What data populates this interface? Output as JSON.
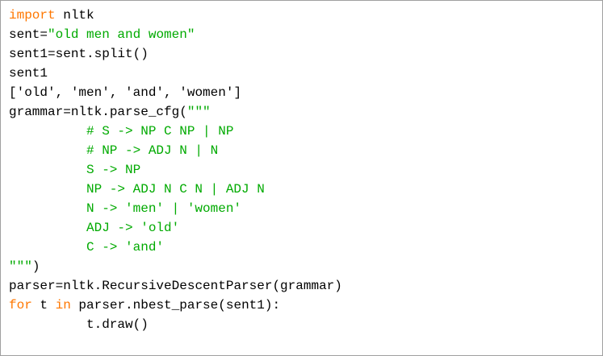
{
  "editor": {
    "lines": [
      {
        "kw": "import",
        "text": " nltk"
      },
      {
        "text": "sent=",
        "str": "\"old men and women\""
      },
      {
        "text": "sent1=sent.split()"
      },
      {
        "text": "sent1"
      },
      {
        "text": "['old', 'men', 'and', 'women']"
      },
      {
        "text": "grammar=nltk.parse_cfg(",
        "str": "\"\"\""
      },
      {
        "str": "# S -> NP C NP | NP"
      },
      {
        "str": "# NP -> ADJ N | N"
      },
      {
        "str": "S -> NP"
      },
      {
        "str": "NP -> ADJ N C N | ADJ N"
      },
      {
        "str": "N -> 'men' | 'women'"
      },
      {
        "str": "ADJ -> 'old'"
      },
      {
        "str": "C -> 'and'"
      },
      {
        "str": "\"\"\"",
        "text": ")"
      },
      {
        "text": "parser=nltk.RecursiveDescentParser(grammar)"
      },
      {
        "kw": "for",
        "text": " t ",
        "kw2": "in",
        "text2": " parser.nbest_parse(sent1):"
      },
      {
        "text": "t.draw()"
      }
    ]
  },
  "colors": {
    "keyword": "#ff7700",
    "string": "#00aa00",
    "default": "#000000",
    "border": "#a0a0a0"
  }
}
